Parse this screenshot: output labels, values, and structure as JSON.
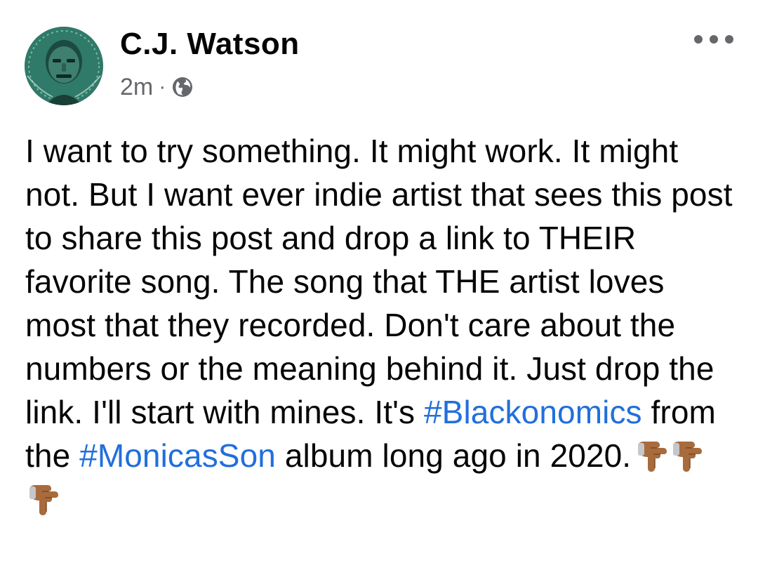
{
  "post": {
    "author": "C.J. Watson",
    "timestamp": "2m",
    "separator": "·",
    "privacy_icon": "globe-icon",
    "more_icon": "more-options-icon",
    "body_segments": [
      "I want to try something. It might work. It might not. But I want ever indie artist that sees this post to share this post and drop a link to THEIR favorite song. The song that THE artist loves most that they recorded. Don't care about the numbers or the meaning behind it. Just drop the link. I'll start with mines. It's ",
      "#Blackonomics",
      " from the ",
      "#MonicasSon",
      " album long ago in 2020."
    ],
    "emojis": [
      "backhand-index-pointing-down-medium-dark",
      "backhand-index-pointing-down-medium-dark",
      "backhand-index-pointing-down-medium-dark"
    ],
    "colors": {
      "text": "#050505",
      "meta": "#65676b",
      "hashtag": "#216fdb",
      "emoji_skin": "#a86b3c"
    }
  }
}
